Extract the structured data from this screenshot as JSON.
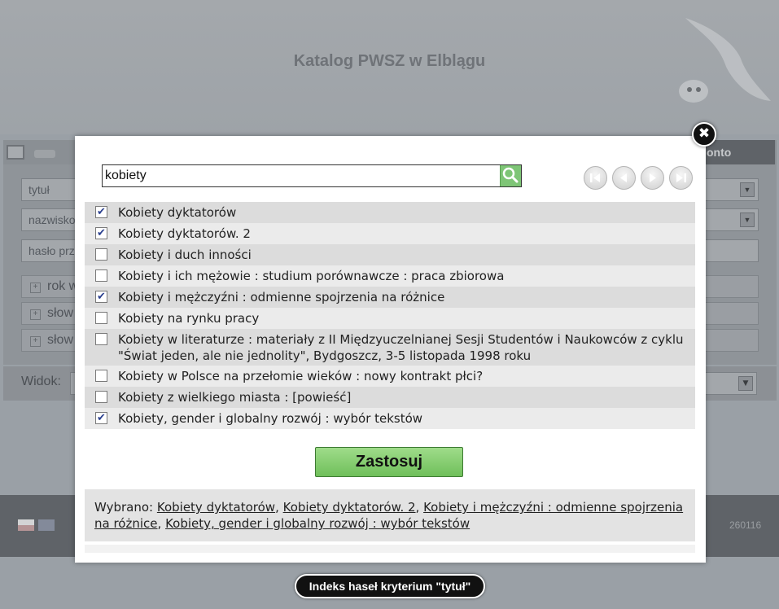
{
  "background": {
    "title": "Katalog PWSZ w Elblągu",
    "konto_label": "onto",
    "fields": [
      "tytuł",
      "nazwisko",
      "hasło prz"
    ],
    "expanders": [
      "rok w",
      "słow",
      "słow"
    ],
    "view_label": "Widok:",
    "version": "260116"
  },
  "modal": {
    "search_value": "kobiety",
    "items": [
      {
        "label": "Kobiety dyktatorów",
        "checked": true
      },
      {
        "label": "Kobiety dyktatorów. 2",
        "checked": true
      },
      {
        "label": "Kobiety i duch inności",
        "checked": false
      },
      {
        "label": "Kobiety i ich mężowie : studium porównawcze : praca zbiorowa",
        "checked": false
      },
      {
        "label": "Kobiety i mężczyźni : odmienne spojrzenia na różnice",
        "checked": true
      },
      {
        "label": "Kobiety na rynku pracy",
        "checked": false
      },
      {
        "label": "Kobiety w literaturze : materiały z II Międzyuczelnianej Sesji Studentów i Naukowców z cyklu \"Świat jeden, ale nie jednolity\", Bydgoszcz, 3-5 listopada 1998 roku",
        "checked": false
      },
      {
        "label": "Kobiety w Polsce na przełomie wieków : nowy kontrakt płci?",
        "checked": false
      },
      {
        "label": "Kobiety z wielkiego miasta : [powieść]",
        "checked": false
      },
      {
        "label": "Kobiety, gender i globalny rozwój : wybór tekstów",
        "checked": true
      }
    ],
    "apply_label": "Zastosuj",
    "selected_prefix": "Wybrano:",
    "selected": [
      "Kobiety dyktatorów",
      "Kobiety dyktatorów. 2",
      "Kobiety i mężczyźni : odmienne spojrzenia na różnice",
      "Kobiety, gender i globalny rozwój : wybór tekstów"
    ],
    "close_symbol": "✖"
  },
  "caption": "Indeks haseł kryterium \"tytuł\"",
  "colors": {
    "apply_green": "#7ec576",
    "search_btn": "#7ec576",
    "overlay": "#9aa0a6"
  }
}
